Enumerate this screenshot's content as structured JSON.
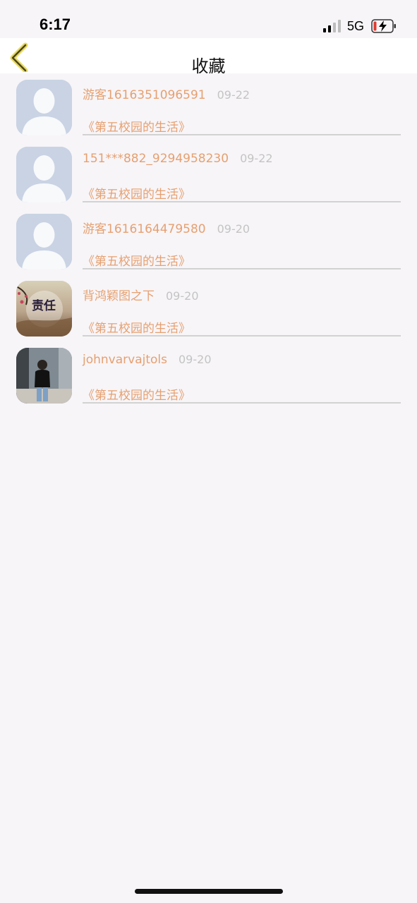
{
  "status_bar": {
    "time": "6:17",
    "network": "5G",
    "signal_bars_active": 2,
    "battery_color": "#e03a2f"
  },
  "nav": {
    "title": "收藏",
    "back_icon": "chevron-left-icon",
    "accent": "#e7d85a"
  },
  "favorites": [
    {
      "name": "游客1616351096591",
      "date": "09-22",
      "work": "《第五校园的生活》",
      "avatar": "default-person-icon"
    },
    {
      "name": "151***882_9294958230",
      "date": "09-22",
      "work": "《第五校园的生活》",
      "avatar": "default-person-icon"
    },
    {
      "name": "游客1616164479580",
      "date": "09-20",
      "work": "《第五校园的生活》",
      "avatar": "default-person-icon"
    },
    {
      "name": "背鸿颖图之下",
      "date": "09-20",
      "work": "《第五校园的生活》",
      "avatar": "photo-avatar",
      "avatar_text": "责任"
    },
    {
      "name": "johnvarvajtols",
      "date": "09-20",
      "work": "《第五校园的生活》",
      "avatar": "photo-avatar"
    }
  ],
  "colors": {
    "name_text": "#e6a070",
    "date_text": "#c4c4c4",
    "background": "#f7f5f8"
  }
}
